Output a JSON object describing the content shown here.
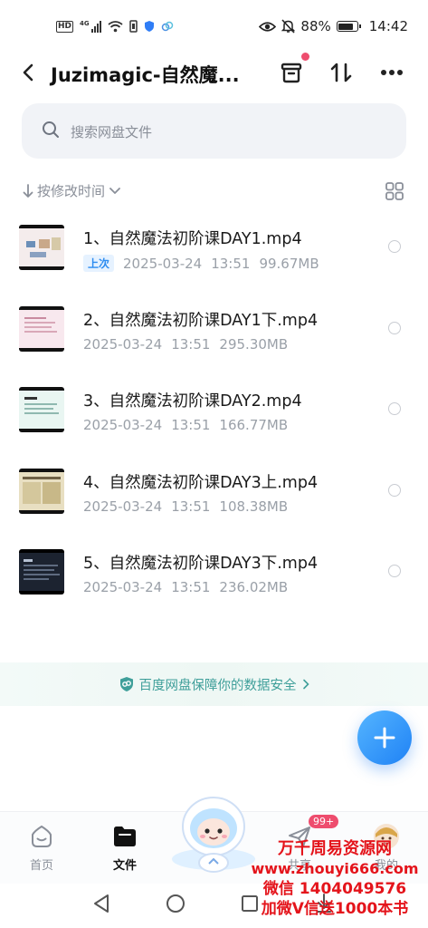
{
  "status_bar": {
    "left_hd": "HD",
    "left_net": "4G",
    "battery_pct": "88%",
    "time": "14:42"
  },
  "header": {
    "title": "Juzimagic-自然魔..."
  },
  "search": {
    "placeholder": "搜索网盘文件"
  },
  "sort": {
    "label": "按修改时间"
  },
  "files": [
    {
      "name": "1、自然魔法初阶课DAY1.mp4",
      "badge": "上次",
      "date": "2025-03-24",
      "time": "13:51",
      "size": "99.67MB"
    },
    {
      "name": "2、自然魔法初阶课DAY1下.mp4",
      "badge": "",
      "date": "2025-03-24",
      "time": "13:51",
      "size": "295.30MB"
    },
    {
      "name": "3、自然魔法初阶课DAY2.mp4",
      "badge": "",
      "date": "2025-03-24",
      "time": "13:51",
      "size": "166.77MB"
    },
    {
      "name": "4、自然魔法初阶课DAY3上.mp4",
      "badge": "",
      "date": "2025-03-24",
      "time": "13:51",
      "size": "108.38MB"
    },
    {
      "name": "5、自然魔法初阶课DAY3下.mp4",
      "badge": "",
      "date": "2025-03-24",
      "time": "13:51",
      "size": "236.02MB"
    }
  ],
  "banner": {
    "text": "百度网盘保障你的数据安全"
  },
  "tabs": {
    "home": "首页",
    "files": "文件",
    "share": "共享",
    "mine": "我的",
    "share_badge": "99+"
  },
  "watermark": {
    "line1": "万千周易资源网",
    "line2": "www.zhouyi666.com",
    "line3": "微信 1404049576",
    "line4": "加微V信送1000本书"
  },
  "colors": {
    "accent": "#2d8cf0",
    "badge_red": "#ee4d6e",
    "banner_teal": "#3f9f9a",
    "watermark_red": "#e4141b"
  }
}
